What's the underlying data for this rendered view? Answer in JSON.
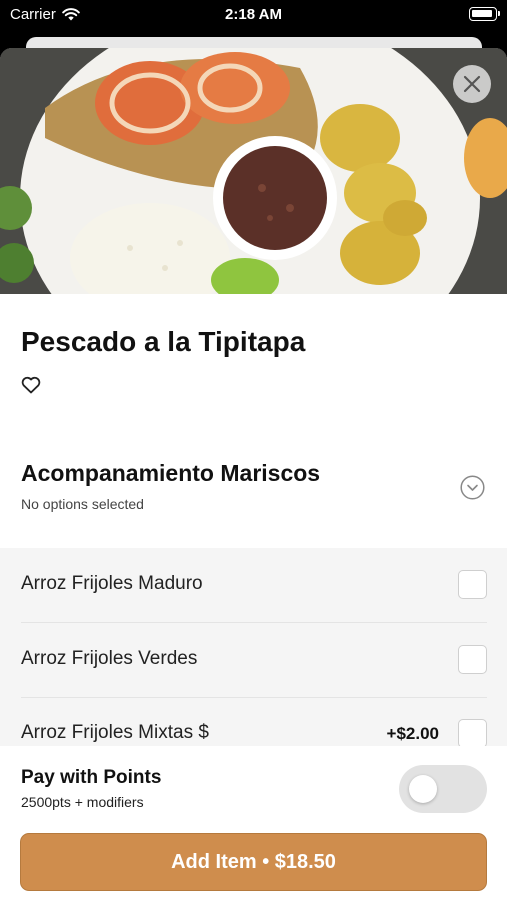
{
  "status_bar": {
    "carrier": "Carrier",
    "time": "2:18 AM"
  },
  "item": {
    "title": "Pescado a la Tipitapa"
  },
  "section": {
    "title": "Acompanamiento Mariscos",
    "subtitle": "No options selected"
  },
  "options": [
    {
      "label": "Arroz Frijoles Maduro",
      "price": "",
      "checked": false
    },
    {
      "label": "Arroz Frijoles Verdes",
      "price": "",
      "checked": false
    },
    {
      "label": "Arroz Frijoles Mixtas $",
      "price": "+$2.00",
      "checked": false
    }
  ],
  "points": {
    "title": "Pay with Points",
    "subtitle": "2500pts + modifiers",
    "enabled": false
  },
  "add_button": {
    "label": "Add Item • $18.50"
  },
  "colors": {
    "accent": "#cf8d4d",
    "toggle_off": "#e2e2e2",
    "options_bg": "#f5f5f5"
  },
  "icons": {
    "close": "close-icon",
    "favorite": "heart-outline-icon",
    "expand": "chevron-down-circle-icon",
    "wifi": "wifi-icon",
    "battery": "battery-icon"
  }
}
